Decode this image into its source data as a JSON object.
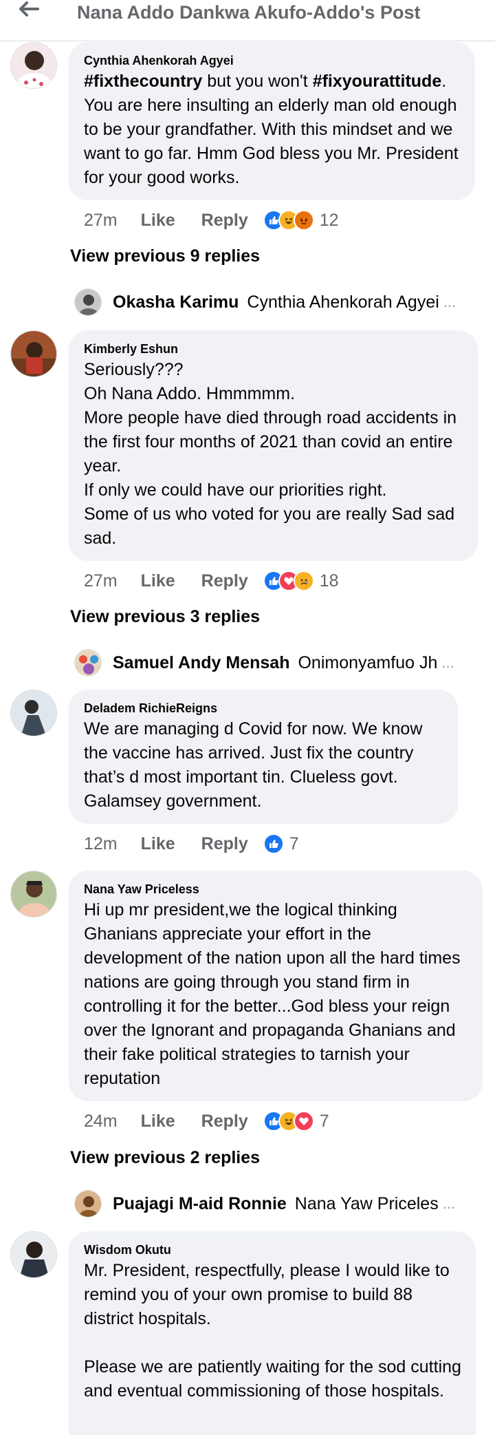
{
  "header": {
    "title": "Nana Addo Dankwa Akufo-Addo's Post"
  },
  "comments": [
    {
      "author": "Cynthia Ahenkorah Agyei",
      "text_parts": [
        "#fixthecountry",
        " but you won't ",
        "#fixyourattitude",
        ". You are here insulting an elderly man old enough to be your grandfather. With this mindset and we want to go far. Hmm God bless you Mr. President for your good works."
      ],
      "time": "27m",
      "like": "Like",
      "reply": "Reply",
      "reaction_count": "12",
      "reactions": [
        "like-reaction-icon",
        "haha-reaction-icon",
        "angry-reaction-icon"
      ]
    },
    {
      "author": "Kimberly Eshun",
      "text": "Seriously???\nOh  Nana Addo. Hmmmmm.\nMore people have died through road accidents in the first four months of 2021 than covid an entire year.\nIf only we could have our priorities right.\nSome of us who voted for you are really  Sad sad sad.",
      "time": "27m",
      "like": "Like",
      "reply": "Reply",
      "reaction_count": "18",
      "reactions": [
        "like-reaction-icon",
        "love-reaction-icon",
        "sad-reaction-icon"
      ]
    },
    {
      "author": "Deladem RichieReigns",
      "text": "We are managing d Covid for now. We know the vaccine has arrived. Just fix the country that’s d most important tin. Clueless govt. Galamsey government.",
      "time": "12m",
      "like": "Like",
      "reply": "Reply",
      "reaction_count": "7",
      "reactions": [
        "like-reaction-icon"
      ]
    },
    {
      "author": "Nana Yaw Priceless",
      "text": "Hi up mr president,we the logical thinking Ghanians appreciate your effort in the development of the nation upon all the hard times nations are going through you stand firm in controlling it for the better...God bless your reign over the Ignorant and propaganda Ghanians and their fake political strategies to tarnish your reputation",
      "time": "24m",
      "like": "Like",
      "reply": "Reply",
      "reaction_count": "7",
      "reactions": [
        "like-reaction-icon",
        "haha-reaction-icon",
        "love-reaction-icon"
      ]
    },
    {
      "author": "Wisdom Okutu",
      "text": "Mr. President, respectfully, please I would like to remind you of your own promise to build 88 district hospitals.\n\nPlease we are patiently waiting for the sod cutting and eventual commissioning of those hospitals."
    }
  ],
  "view_previous": [
    "View previous 9 replies",
    "View previous 3 replies",
    "View previous 2 replies"
  ],
  "reply_previews": [
    {
      "name": "Okasha Karimu",
      "text": "Cynthia Ahenkorah Agyei",
      "ellipsis": "..."
    },
    {
      "name": "Samuel Andy Mensah",
      "text": "Onimonyamfuo Jh",
      "ellipsis": "..."
    },
    {
      "name": "Puajagi M-aid Ronnie",
      "text": "Nana Yaw Priceles",
      "ellipsis": "..."
    }
  ],
  "colors": {
    "like_blue": "#1877f2",
    "love_red": "#f33e58",
    "haha_yellow": "#f7b125",
    "angry_orange": "#e9710f",
    "bubble_bg": "#f0f2f5",
    "meta_gray": "#65676b"
  }
}
